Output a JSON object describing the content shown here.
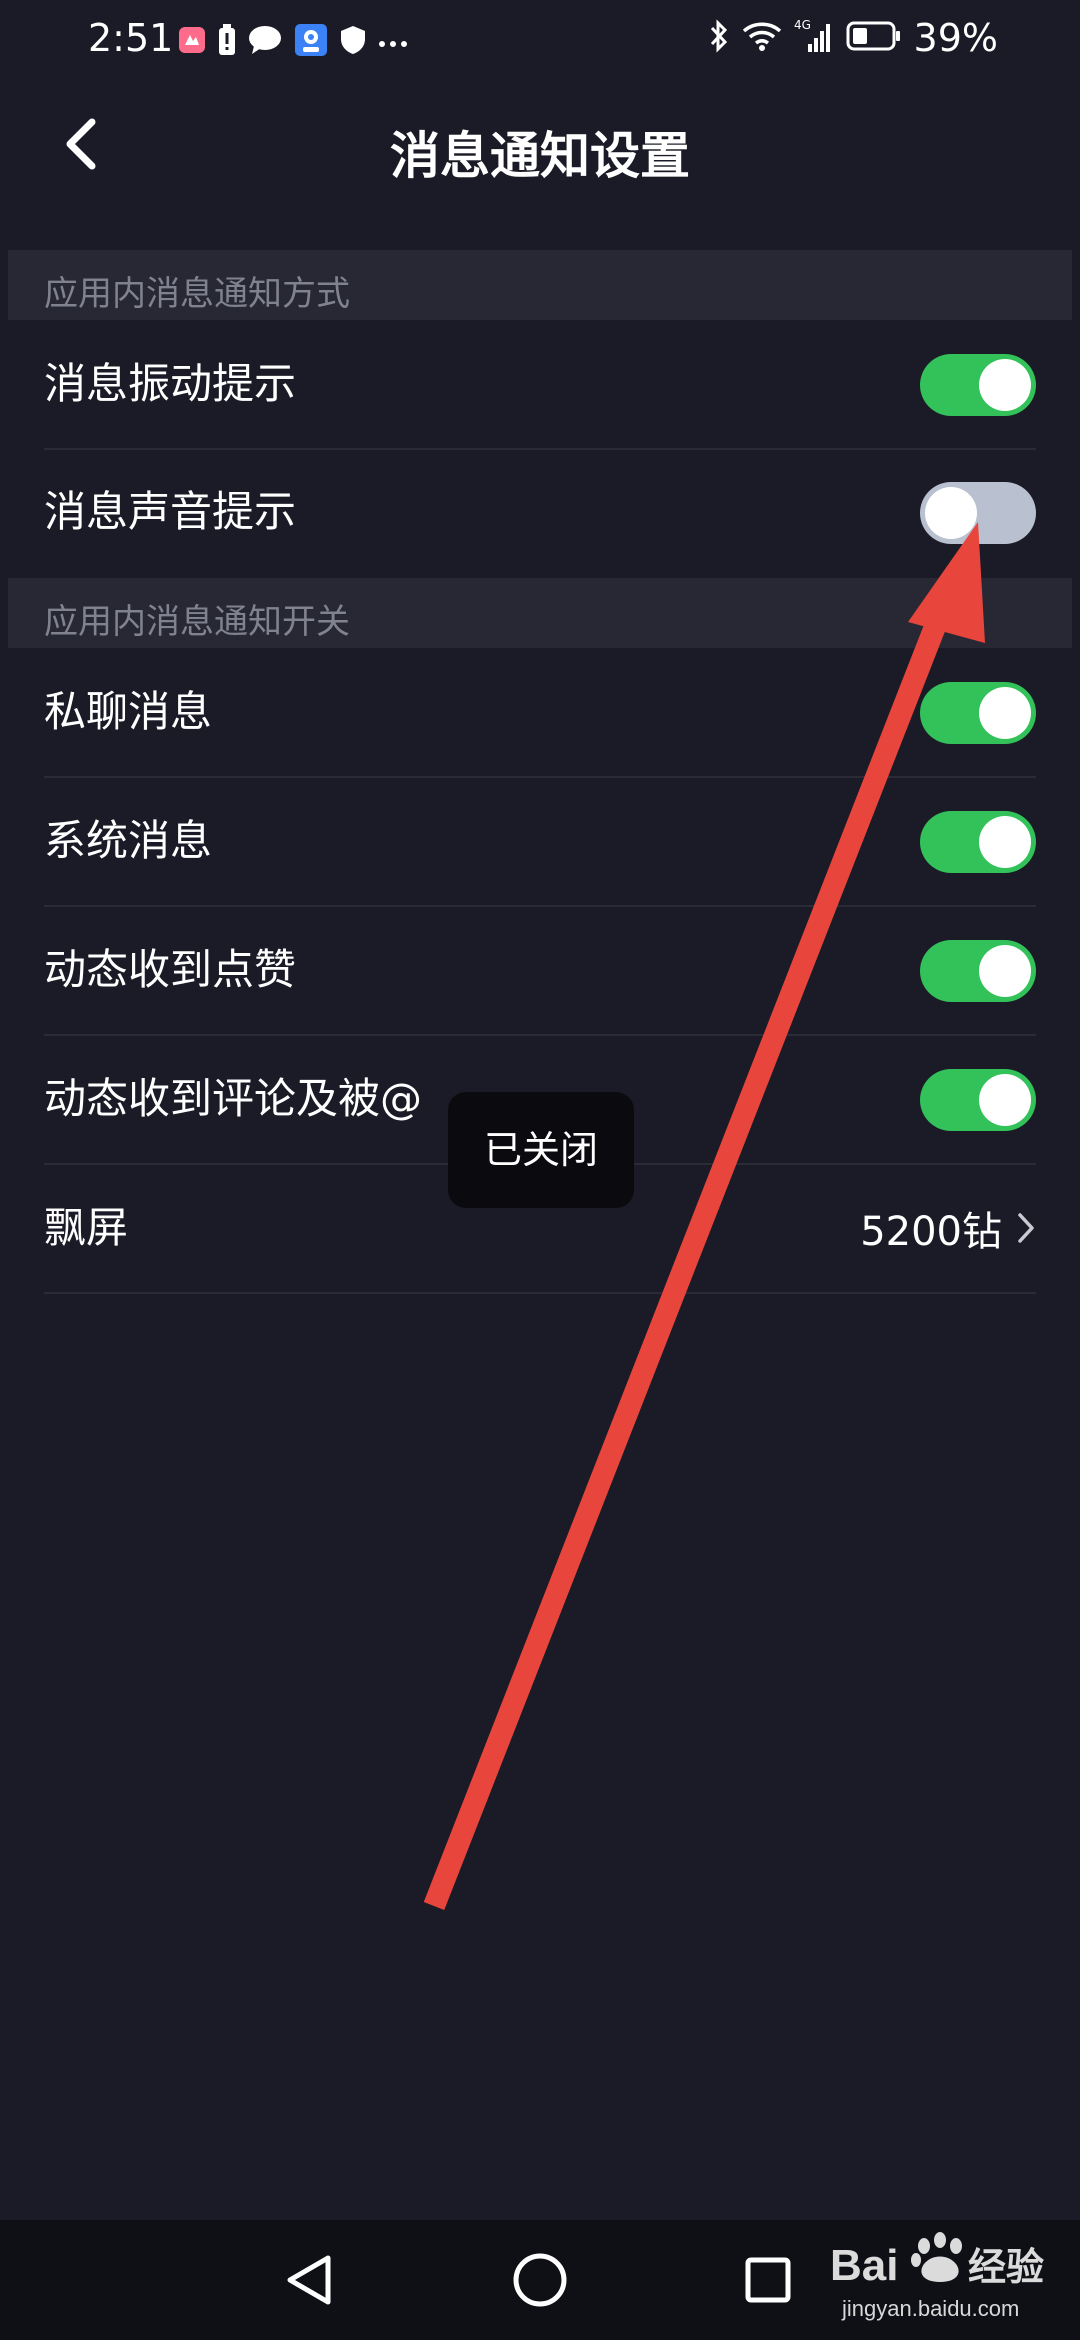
{
  "status_bar": {
    "time": "2:51",
    "network": "4G",
    "battery_percent": "39%",
    "battery_level": 0.39,
    "icons": [
      "app-notification-icon",
      "battery-alert-icon",
      "chat-bubble-icon",
      "camera-app-icon",
      "shield-icon",
      "more-dots-icon",
      "bluetooth-icon",
      "wifi-icon",
      "cellular-signal-icon",
      "battery-icon"
    ]
  },
  "header": {
    "title": "消息通知设置",
    "back_icon": "chevron-left-icon"
  },
  "sections": [
    {
      "title": "应用内消息通知方式",
      "items": [
        {
          "label": "消息振动提示",
          "toggle": true
        },
        {
          "label": "消息声音提示",
          "toggle": false
        }
      ]
    },
    {
      "title": "应用内消息通知开关",
      "items": [
        {
          "label": "私聊消息",
          "toggle": true
        },
        {
          "label": "系统消息",
          "toggle": true
        },
        {
          "label": "动态收到点赞",
          "toggle": true
        },
        {
          "label": "动态收到评论及被@",
          "toggle": true
        },
        {
          "label": "飘屏",
          "value": "5200钻",
          "chevron": "chevron-right-icon"
        }
      ]
    }
  ],
  "toast": {
    "text": "已关闭"
  },
  "colors": {
    "background": "#1a1b26",
    "section_header": "#272834",
    "toggle_on": "#33c15a",
    "toggle_off": "#b9c0cf",
    "annotation_arrow": "#e8453c"
  },
  "nav_bar": {
    "icons": [
      "back-triangle-icon",
      "home-circle-icon",
      "recents-square-icon"
    ]
  },
  "watermark": {
    "brand": "Baidu经验",
    "url": "jingyan.baidu.com"
  }
}
